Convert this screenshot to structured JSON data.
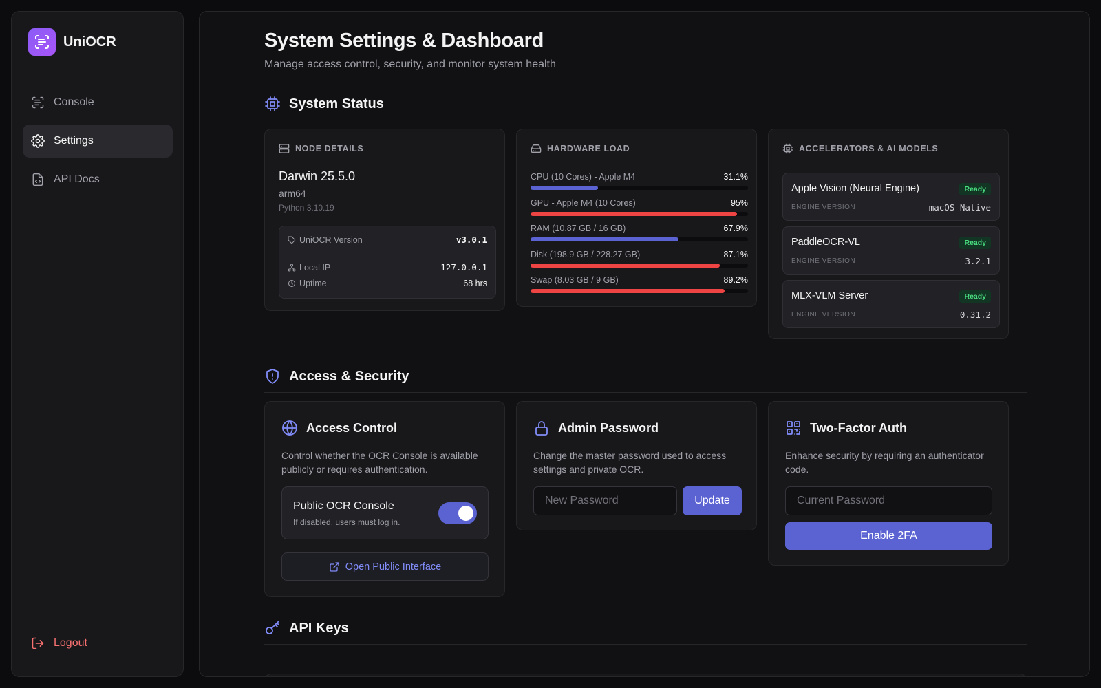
{
  "brand": {
    "name": "UniOCR",
    "icon": "scan-text-icon",
    "accent": "#8b5cf6"
  },
  "nav": {
    "items": [
      {
        "label": "Console",
        "icon": "scan-text-icon"
      },
      {
        "label": "Settings",
        "icon": "gear-icon",
        "active": true
      },
      {
        "label": "API Docs",
        "icon": "file-code-icon"
      }
    ],
    "logout": "Logout"
  },
  "header": {
    "title": "System Settings & Dashboard",
    "subtitle": "Manage access control, security, and monitor system health"
  },
  "system_status": {
    "title": "System Status",
    "node": {
      "label": "NODE DETAILS",
      "os": "Darwin 25.5.0",
      "arch": "arm64",
      "python": "Python 3.10.19",
      "version_label": "UniOCR Version",
      "version_value": "v3.0.1",
      "ip_label": "Local IP",
      "ip_value": "127.0.0.1",
      "uptime_label": "Uptime",
      "uptime_value": "68 hrs"
    },
    "hardware": {
      "label": "HARDWARE LOAD",
      "rows": [
        {
          "name": "CPU (10 Cores) - Apple M4",
          "percent_text": "31.1%",
          "value": 31.1,
          "color": "#5b63d3"
        },
        {
          "name": "GPU - Apple M4 (10 Cores)",
          "percent_text": "95%",
          "value": 95,
          "color": "#ef4444"
        },
        {
          "name": "RAM (10.87 GB / 16 GB)",
          "percent_text": "67.9%",
          "value": 67.9,
          "color": "#5b63d3"
        },
        {
          "name": "Disk (198.9 GB / 228.27 GB)",
          "percent_text": "87.1%",
          "value": 87.1,
          "color": "#ef4444"
        },
        {
          "name": "Swap (8.03 GB / 9 GB)",
          "percent_text": "89.2%",
          "value": 89.2,
          "color": "#ef4444"
        }
      ]
    },
    "accelerators": {
      "label": "ACCELERATORS & AI MODELS",
      "version_label": "ENGINE VERSION",
      "items": [
        {
          "name": "Apple Vision (Neural Engine)",
          "status": "Ready",
          "version": "macOS Native"
        },
        {
          "name": "PaddleOCR-VL",
          "status": "Ready",
          "version": "3.2.1"
        },
        {
          "name": "MLX-VLM Server",
          "status": "Ready",
          "version": "0.31.2"
        }
      ]
    }
  },
  "security": {
    "title": "Access & Security",
    "access_control": {
      "title": "Access Control",
      "description": "Control whether the OCR Console is available publicly or requires authentication.",
      "toggle_title": "Public OCR Console",
      "toggle_sub": "If disabled, users must log in.",
      "toggle_on": true,
      "open_button": "Open Public Interface"
    },
    "admin_password": {
      "title": "Admin Password",
      "description": "Change the master password used to access settings and private OCR.",
      "input_placeholder": "New Password",
      "input_value": "",
      "button": "Update"
    },
    "two_factor": {
      "title": "Two-Factor Auth",
      "description": "Enhance security by requiring an authenticator code.",
      "input_placeholder": "Current Password",
      "input_value": "",
      "button": "Enable 2FA"
    }
  },
  "api_keys": {
    "title": "API Keys"
  },
  "colors": {
    "primary": "#5b63d3",
    "danger": "#ef4444",
    "success": "#4ade80"
  }
}
